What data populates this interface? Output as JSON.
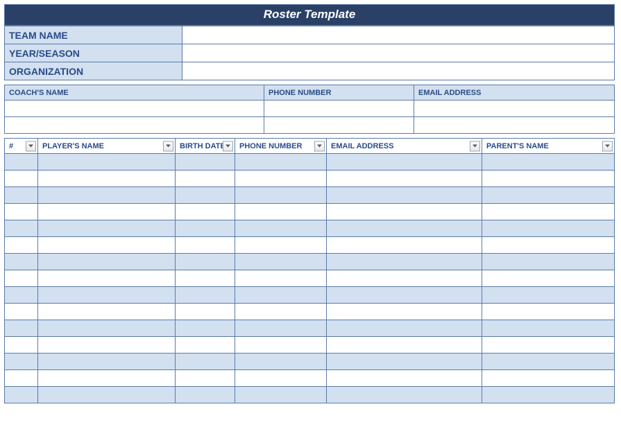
{
  "title": "Roster Template",
  "info": {
    "team_name_label": "TEAM NAME",
    "team_name_value": "",
    "year_season_label": "YEAR/SEASON",
    "year_season_value": "",
    "organization_label": "ORGANIZATION",
    "organization_value": ""
  },
  "coach": {
    "headers": {
      "name": "COACH'S NAME",
      "phone": "PHONE NUMBER",
      "email": "EMAIL ADDRESS"
    },
    "rows": [
      {
        "name": "",
        "phone": "",
        "email": ""
      },
      {
        "name": "",
        "phone": "",
        "email": ""
      }
    ]
  },
  "players": {
    "headers": {
      "num": "#",
      "name": "PLAYER'S NAME",
      "birth": "BIRTH DATE",
      "phone": "PHONE NUMBER",
      "email": "EMAIL ADDRESS",
      "parent": "PARENT'S NAME"
    },
    "rows": [
      {
        "num": "",
        "name": "",
        "birth": "",
        "phone": "",
        "email": "",
        "parent": ""
      },
      {
        "num": "",
        "name": "",
        "birth": "",
        "phone": "",
        "email": "",
        "parent": ""
      },
      {
        "num": "",
        "name": "",
        "birth": "",
        "phone": "",
        "email": "",
        "parent": ""
      },
      {
        "num": "",
        "name": "",
        "birth": "",
        "phone": "",
        "email": "",
        "parent": ""
      },
      {
        "num": "",
        "name": "",
        "birth": "",
        "phone": "",
        "email": "",
        "parent": ""
      },
      {
        "num": "",
        "name": "",
        "birth": "",
        "phone": "",
        "email": "",
        "parent": ""
      },
      {
        "num": "",
        "name": "",
        "birth": "",
        "phone": "",
        "email": "",
        "parent": ""
      },
      {
        "num": "",
        "name": "",
        "birth": "",
        "phone": "",
        "email": "",
        "parent": ""
      },
      {
        "num": "",
        "name": "",
        "birth": "",
        "phone": "",
        "email": "",
        "parent": ""
      },
      {
        "num": "",
        "name": "",
        "birth": "",
        "phone": "",
        "email": "",
        "parent": ""
      },
      {
        "num": "",
        "name": "",
        "birth": "",
        "phone": "",
        "email": "",
        "parent": ""
      },
      {
        "num": "",
        "name": "",
        "birth": "",
        "phone": "",
        "email": "",
        "parent": ""
      },
      {
        "num": "",
        "name": "",
        "birth": "",
        "phone": "",
        "email": "",
        "parent": ""
      },
      {
        "num": "",
        "name": "",
        "birth": "",
        "phone": "",
        "email": "",
        "parent": ""
      },
      {
        "num": "",
        "name": "",
        "birth": "",
        "phone": "",
        "email": "",
        "parent": ""
      }
    ]
  }
}
